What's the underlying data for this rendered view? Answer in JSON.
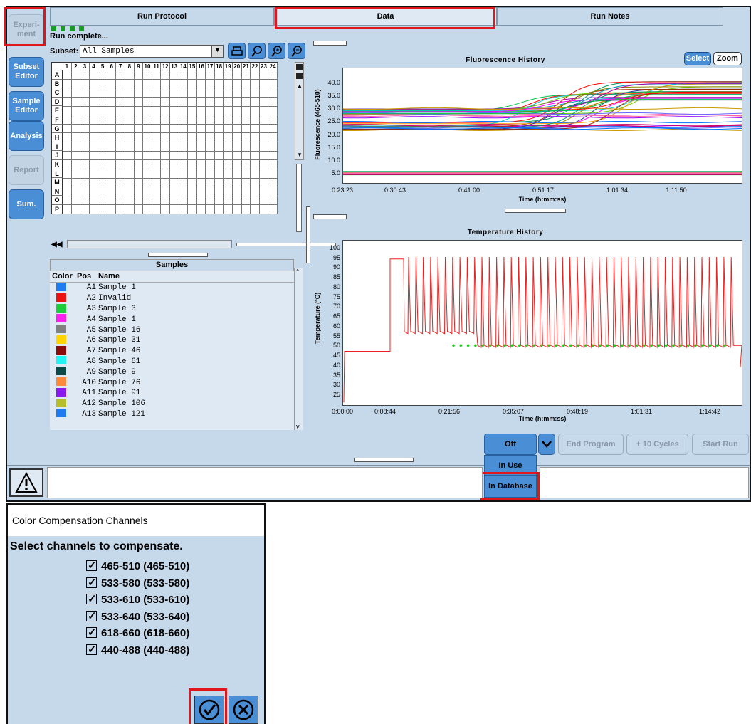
{
  "sidebar": [
    {
      "label": "Experi- ment",
      "enabled": false
    },
    {
      "label": "Subset Editor",
      "enabled": true
    },
    {
      "label": "Sample Editor",
      "enabled": true
    },
    {
      "label": "Analysis",
      "enabled": true
    },
    {
      "label": "Report",
      "enabled": false
    },
    {
      "label": "Sum.",
      "enabled": true
    }
  ],
  "tabs": [
    "Run Protocol",
    "Data",
    "Run Notes"
  ],
  "status_text": "Run complete...",
  "subset": {
    "label": "Subset:",
    "value": "All Samples"
  },
  "plate": {
    "columns": [
      "1",
      "2",
      "3",
      "4",
      "5",
      "6",
      "7",
      "8",
      "9",
      "10",
      "11",
      "12",
      "13",
      "14",
      "15",
      "16",
      "17",
      "18",
      "19",
      "20",
      "21",
      "22",
      "23",
      "24"
    ],
    "rows": [
      "A",
      "B",
      "C",
      "D",
      "E",
      "F",
      "G",
      "H",
      "I",
      "J",
      "K",
      "L",
      "M",
      "N",
      "O",
      "P"
    ]
  },
  "samples": {
    "title": "Samples",
    "headers": [
      "Color",
      "Pos",
      "Name"
    ],
    "rows": [
      {
        "color": "#1e7bf0",
        "pos": "A1",
        "name": "Sample 1"
      },
      {
        "color": "#ee1111",
        "pos": "A2",
        "name": "Invalid"
      },
      {
        "color": "#1fcc3a",
        "pos": "A3",
        "name": "Sample 3"
      },
      {
        "color": "#ff22ee",
        "pos": "A4",
        "name": "Sample 1"
      },
      {
        "color": "#808080",
        "pos": "A5",
        "name": "Sample 16"
      },
      {
        "color": "#ffd400",
        "pos": "A6",
        "name": "Sample 31"
      },
      {
        "color": "#8b0a0a",
        "pos": "A7",
        "name": "Sample 46"
      },
      {
        "color": "#22f4f4",
        "pos": "A8",
        "name": "Sample 61"
      },
      {
        "color": "#0c4a4a",
        "pos": "A9",
        "name": "Sample 9"
      },
      {
        "color": "#ff8a3c",
        "pos": "A10",
        "name": "Sample 76"
      },
      {
        "color": "#8a1aee",
        "pos": "A11",
        "name": "Sample 91"
      },
      {
        "color": "#b6bf2a",
        "pos": "A12",
        "name": "Sample 106"
      },
      {
        "color": "#1e7bf0",
        "pos": "A13",
        "name": "Sample 121"
      }
    ]
  },
  "fluorescence_chart": {
    "title": "Fluorescence History",
    "ylabel": "Fluorescence (465-510)",
    "xlabel": "Time (h:mm:ss)",
    "yticks": [
      "5.0",
      "10.0",
      "15.0",
      "20.0",
      "25.0",
      "30.0",
      "35.0",
      "40.0"
    ],
    "xticks": [
      "0:23:23",
      "0:30:43",
      "0:41:00",
      "0:51:17",
      "1:01:34",
      "1:11:50"
    ],
    "select_label": "Select",
    "zoom_label": "Zoom"
  },
  "temperature_chart": {
    "title": "Temperature History",
    "ylabel": "Temperature (°C)",
    "xlabel": "Time (h:mm:ss)",
    "yticks": [
      "25",
      "30",
      "35",
      "40",
      "45",
      "50",
      "55",
      "60",
      "65",
      "70",
      "75",
      "80",
      "85",
      "90",
      "95",
      "100"
    ],
    "xticks": [
      "0:00:00",
      "0:08:44",
      "0:21:56",
      "0:35:07",
      "0:48:19",
      "1:01:31",
      "1:14:42"
    ]
  },
  "controls": {
    "off_label": "Off",
    "end_program": "End Program",
    "plus_cycles": "+ 10 Cycles",
    "start_run": "Start Run",
    "menu_items": [
      "In Use",
      "In Database"
    ]
  },
  "dialog": {
    "title": "Color Compensation Channels",
    "prompt": "Select channels to compensate.",
    "channels": [
      "465-510 (465-510)",
      "533-580 (533-580)",
      "533-610 (533-610)",
      "533-640 (533-640)",
      "618-660 (618-660)",
      "440-488 (440-488)"
    ]
  },
  "colors": {
    "panel": "#c6d9ea",
    "button": "#4a8fd6",
    "highlight": "#e0161b",
    "temperature_line": "#ee2020",
    "temperature_marker": "#22cc22"
  }
}
